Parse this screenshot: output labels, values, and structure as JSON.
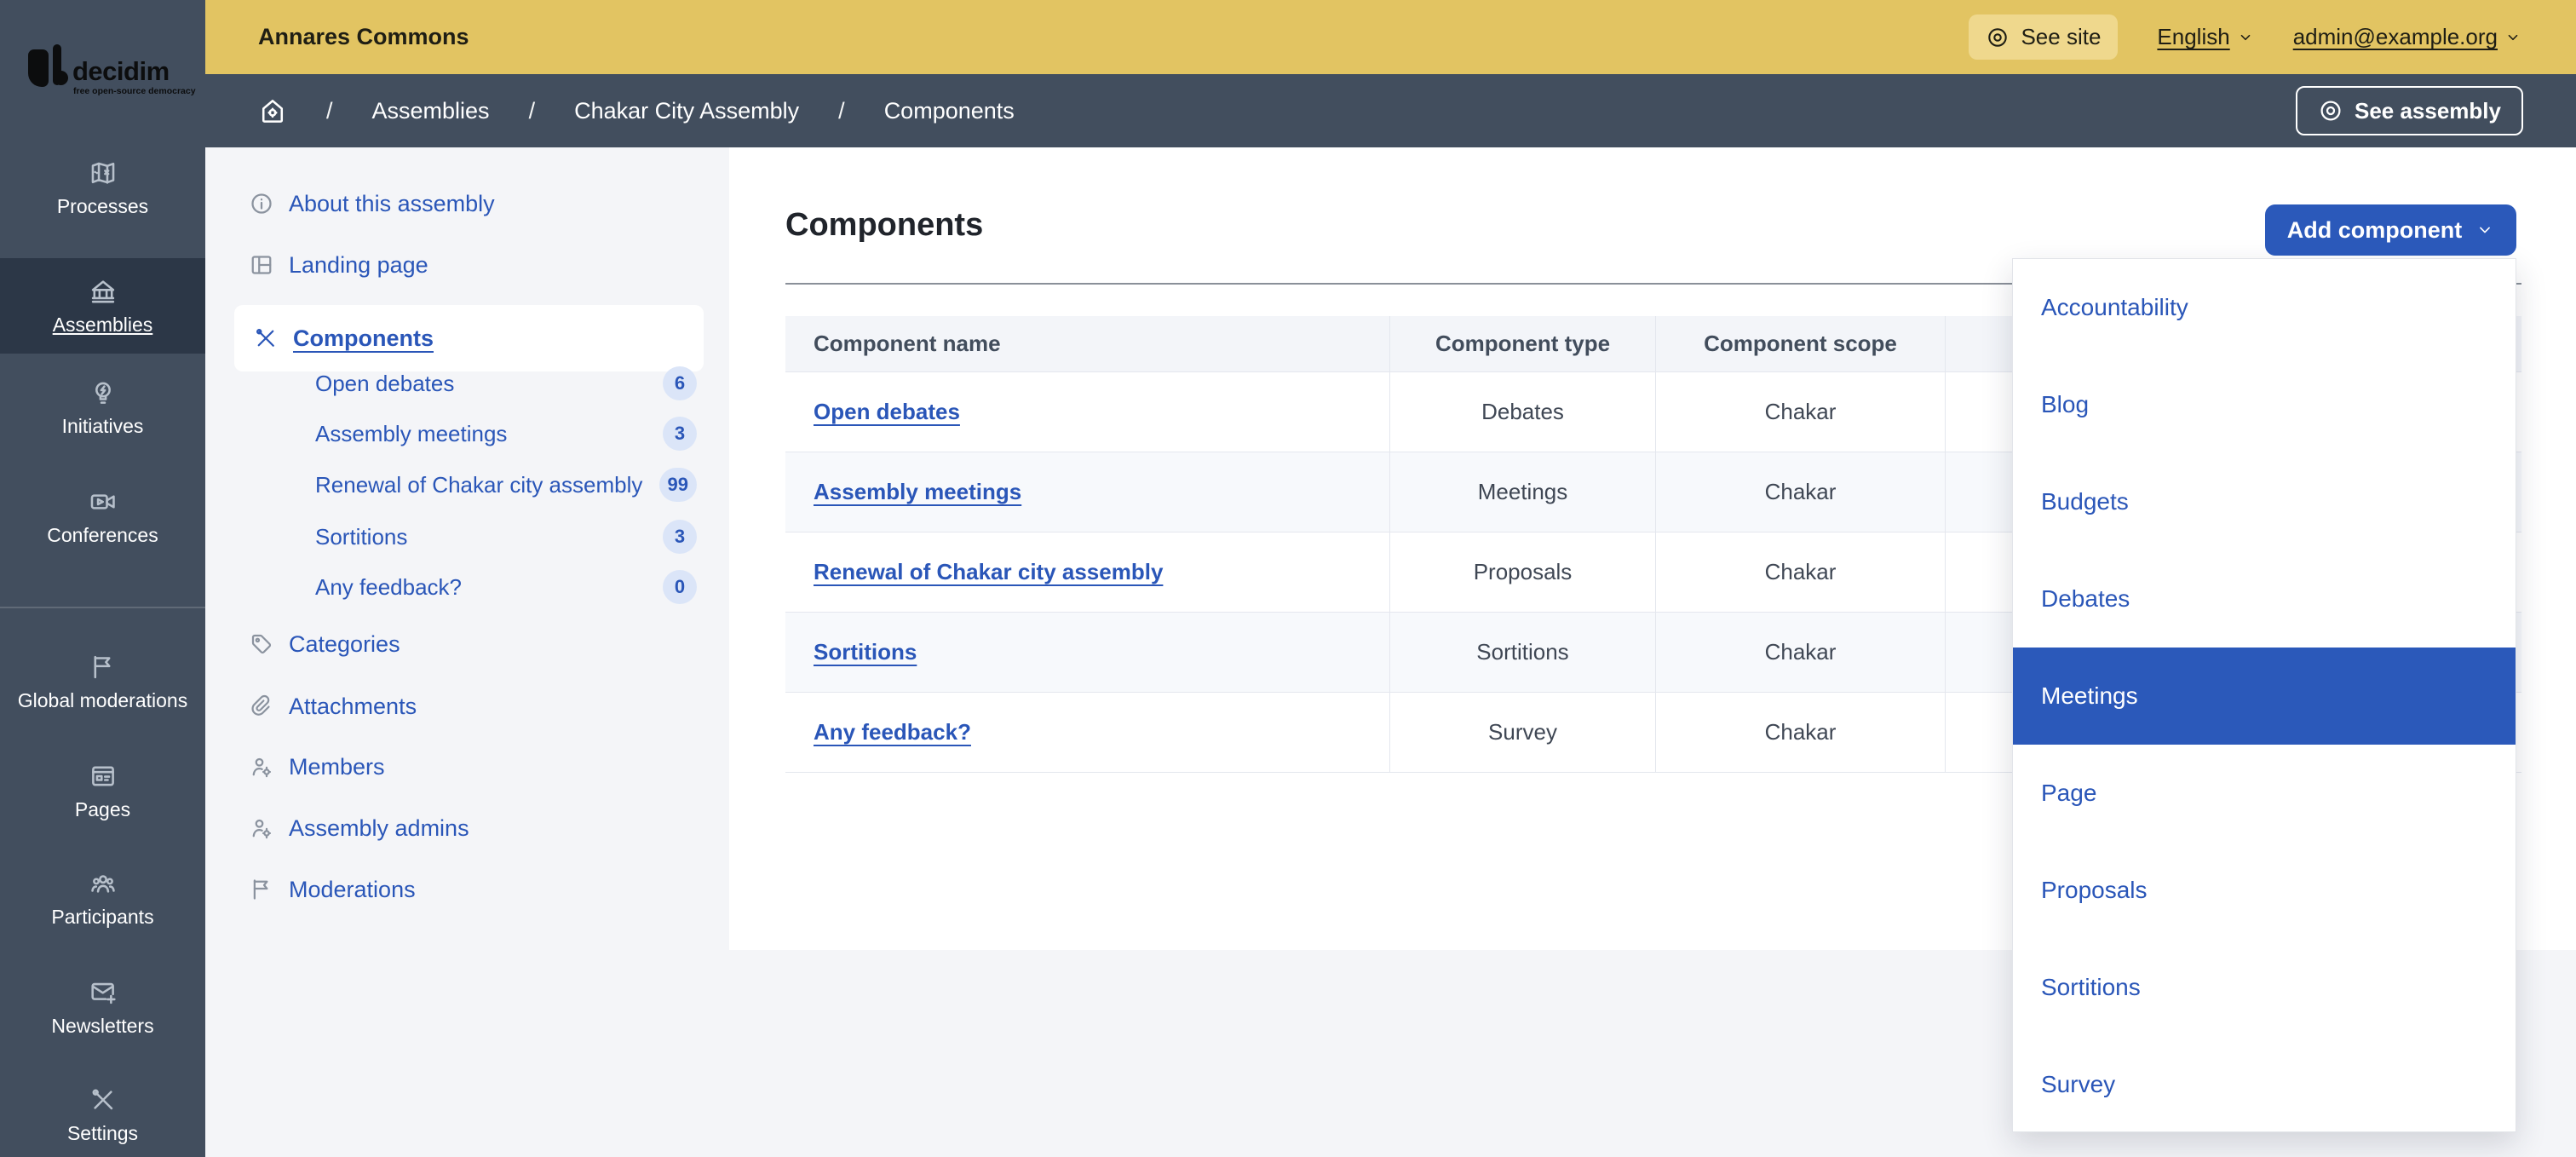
{
  "colors": {
    "topbar_yellow": "#e2c462",
    "topbar_chip": "#efd88d",
    "sidebar_dark": "#424e5e",
    "sidebar_active": "#2c3747",
    "primary_blue": "#2b59ba",
    "link_blue": "#2a56b8",
    "page_bg": "#f4f5f8",
    "table_header_bg": "#f3f5f9",
    "row_alt_bg": "#f7f9fc",
    "border": "#e4e7ee",
    "badge_bg": "#dbe5f8"
  },
  "brand": {
    "name": "decidim",
    "tagline": "free open-source democracy"
  },
  "topbar": {
    "title": "Annares Commons",
    "see_site": "See site",
    "language": "English",
    "user_email": "admin@example.org"
  },
  "breadcrumb": {
    "sep": "/",
    "items": [
      {
        "label": "Assemblies"
      },
      {
        "label": "Chakar City Assembly"
      },
      {
        "label": "Components"
      }
    ],
    "see_assembly": "See assembly"
  },
  "sidebar": {
    "items": [
      {
        "label": "Processes",
        "icon": "map-icon"
      },
      {
        "label": "Assemblies",
        "icon": "bank-icon",
        "active": true
      },
      {
        "label": "Initiatives",
        "icon": "lightbulb-icon"
      },
      {
        "label": "Conferences",
        "icon": "video-icon"
      },
      {
        "label": "Global moderations",
        "icon": "flag-icon"
      },
      {
        "label": "Pages",
        "icon": "newspaper-icon"
      },
      {
        "label": "Participants",
        "icon": "people-icon"
      },
      {
        "label": "Newsletters",
        "icon": "mail-plus-icon"
      },
      {
        "label": "Settings",
        "icon": "tools-icon"
      }
    ]
  },
  "assembly_menu": {
    "about": "About this assembly",
    "landing": "Landing page",
    "components": "Components",
    "component_items": [
      {
        "label": "Open debates",
        "count": "6"
      },
      {
        "label": "Assembly meetings",
        "count": "3"
      },
      {
        "label": "Renewal of Chakar city assembly",
        "count": "99"
      },
      {
        "label": "Sortitions",
        "count": "3"
      },
      {
        "label": "Any feedback?",
        "count": "0"
      }
    ],
    "more": [
      {
        "label": "Categories",
        "icon": "tag-icon"
      },
      {
        "label": "Attachments",
        "icon": "paperclip-icon"
      },
      {
        "label": "Members",
        "icon": "user-gear-icon"
      },
      {
        "label": "Assembly admins",
        "icon": "user-gear-icon"
      },
      {
        "label": "Moderations",
        "icon": "flag-icon"
      }
    ]
  },
  "main": {
    "title": "Components",
    "add_button": "Add component",
    "table": {
      "headers": [
        "Component name",
        "Component type",
        "Component scope"
      ],
      "rows": [
        {
          "name": "Open debates",
          "type": "Debates",
          "scope": "Chakar"
        },
        {
          "name": "Assembly meetings",
          "type": "Meetings",
          "scope": "Chakar"
        },
        {
          "name": "Renewal of Chakar city assembly",
          "type": "Proposals",
          "scope": "Chakar"
        },
        {
          "name": "Sortitions",
          "type": "Sortitions",
          "scope": "Chakar"
        },
        {
          "name": "Any feedback?",
          "type": "Survey",
          "scope": "Chakar"
        }
      ]
    }
  },
  "dropdown": {
    "selected": "Meetings",
    "items": [
      {
        "label": "Accountability"
      },
      {
        "label": "Blog"
      },
      {
        "label": "Budgets"
      },
      {
        "label": "Debates"
      },
      {
        "label": "Meetings",
        "selected": true
      },
      {
        "label": "Page"
      },
      {
        "label": "Proposals"
      },
      {
        "label": "Sortitions"
      },
      {
        "label": "Survey"
      }
    ]
  }
}
